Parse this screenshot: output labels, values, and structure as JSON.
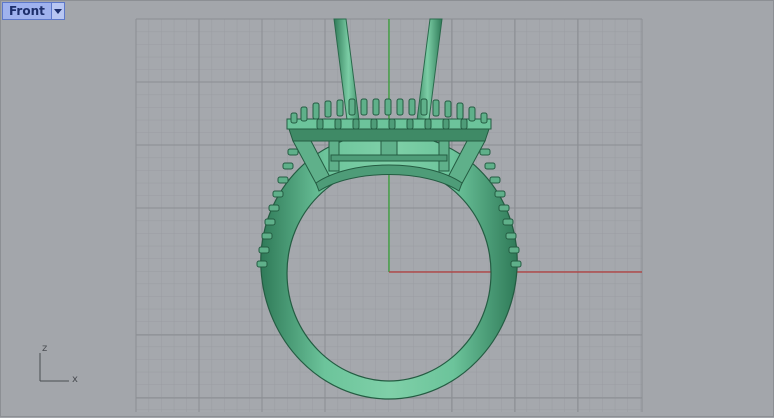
{
  "viewport": {
    "name": "Front",
    "menu_icon": "chevron-down-icon"
  },
  "axis_gizmo": {
    "vertical_label": "z",
    "horizontal_label": "x"
  },
  "colors": {
    "background": "#a3a6ab",
    "grid_minor": "#9a9da2",
    "grid_major": "#8f9297",
    "x_axis": "#b33a3a",
    "z_axis": "#2fa02f",
    "model_fill": "#5fb08a",
    "model_dark": "#2f7a58",
    "model_light": "#86d2ac"
  }
}
